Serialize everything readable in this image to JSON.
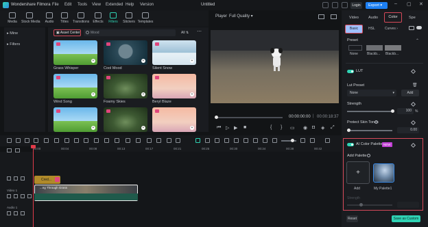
{
  "titlebar": {
    "app_name": "Wondershare Filmora",
    "menus": [
      "File",
      "Edit",
      "Tools",
      "View",
      "Extended",
      "Help",
      "Version"
    ],
    "doc_title": "Untitled",
    "login_label": "Login",
    "export_label": "Export"
  },
  "media_toolbar": {
    "items": [
      "Media",
      "Stock Media",
      "Audio",
      "Titles",
      "Transitions",
      "Effects",
      "Filters",
      "Stickers",
      "Templates"
    ],
    "active": "Filters"
  },
  "left_nav": {
    "items": [
      "Mine",
      "Filters"
    ]
  },
  "filters_panel": {
    "asset_center": "Asset Center",
    "search_value": "Mood",
    "ai_label": "All",
    "tiles": [
      {
        "label": "Grass Whisper",
        "style": "sky"
      },
      {
        "label": "Cool Mood",
        "style": "portrait"
      },
      {
        "label": "Silent Snow",
        "style": "snow"
      },
      {
        "label": "Wind Song",
        "style": "sky"
      },
      {
        "label": "Foamy Skies",
        "style": "green"
      },
      {
        "label": "Beryl Blaze",
        "style": "balloon"
      },
      {
        "label": "",
        "style": "sky"
      },
      {
        "label": "",
        "style": "green"
      },
      {
        "label": "",
        "style": "balloon"
      }
    ]
  },
  "player": {
    "label": "Player",
    "quality": "Full Quality",
    "timecode_current": "00:00:00:00",
    "timecode_total": "00:00:18:37"
  },
  "right_panel": {
    "tabs": [
      "Video",
      "Audio",
      "Color",
      "Spe"
    ],
    "active_tab": "Color",
    "subtabs": [
      "Basic",
      "HSL",
      "Curves"
    ],
    "preset_label": "Preset",
    "preset_items": [
      "None",
      "Blackb...",
      "Blackb..."
    ],
    "lut_label": "LUT",
    "lut_preset_label": "Lut Preset",
    "lut_preset_value": "None",
    "add_label": "Add",
    "strength_label": "Strength",
    "strength_value": "100",
    "strength_unit": "%",
    "protect_skin_label": "Protect Skin Tones",
    "protect_skin_value": "0.00",
    "ai_palette_label": "AI Color Palette",
    "new_badge": "NEW",
    "add_palette_label": "Add Palette",
    "add_tile_label": "Add",
    "palette_name": "My Palette1",
    "palette_strength_label": "Strength",
    "reset_label": "Reset",
    "save_custom_label": "Save as Custom"
  },
  "timeline": {
    "ticks": [
      "00:00",
      "00:04",
      "00:08",
      "00:13",
      "00:17",
      "00:21",
      "00:25",
      "00:30",
      "00:34",
      "00:38",
      "00:42"
    ],
    "track_labels": [
      "Video 1",
      "Audio 1"
    ],
    "title_clip": "Cred...",
    "video_clip": "...ng Through Grass"
  },
  "colors": {
    "accent": "#2fd3b4",
    "highlight": "#d84a5a",
    "export": "#1d7ff2"
  }
}
